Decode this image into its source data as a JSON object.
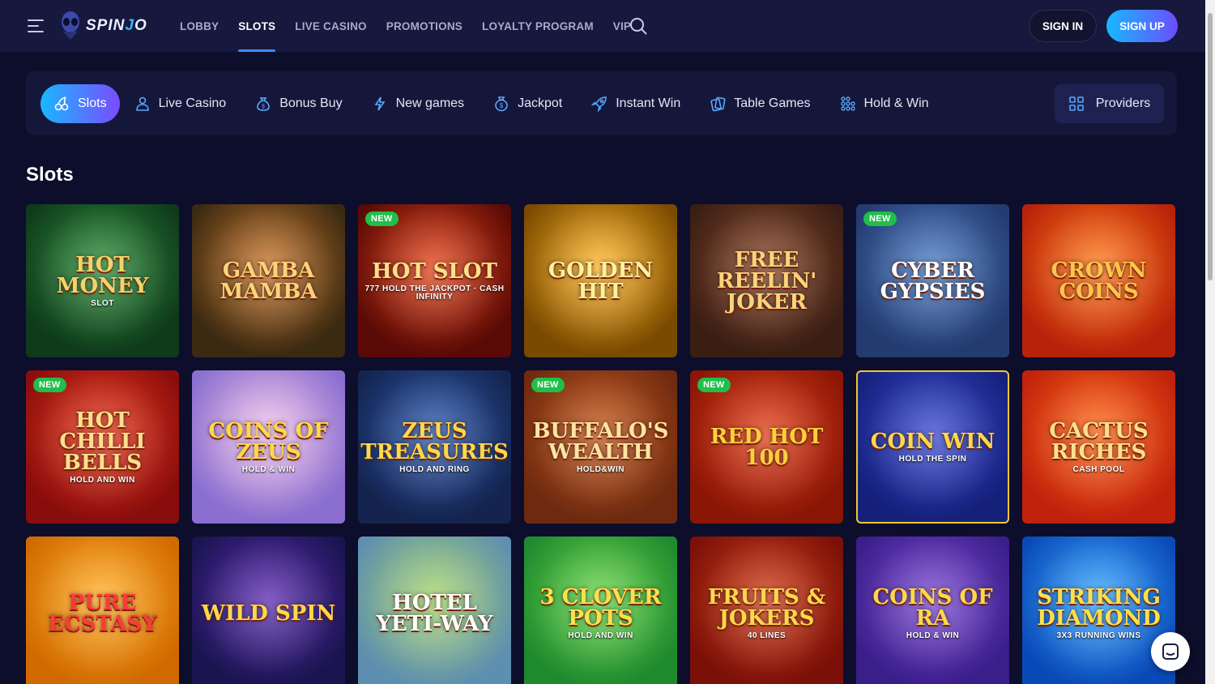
{
  "brand": {
    "logo_text_a": "SPIN",
    "logo_text_b": "J",
    "logo_text_c": "O"
  },
  "nav": {
    "items": [
      {
        "label": "LOBBY",
        "active": false
      },
      {
        "label": "SLOTS",
        "active": true
      },
      {
        "label": "LIVE CASINO",
        "active": false
      },
      {
        "label": "PROMOTIONS",
        "active": false
      },
      {
        "label": "LOYALTY PROGRAM",
        "active": false
      },
      {
        "label": "VIP",
        "active": false
      }
    ],
    "search_icon": "search-icon",
    "signin_label": "SIGN IN",
    "signup_label": "SIGN UP"
  },
  "categories": {
    "items": [
      {
        "label": "Slots",
        "icon": "cherries-icon"
      },
      {
        "label": "Live Casino",
        "icon": "dealer-icon"
      },
      {
        "label": "Bonus Buy",
        "icon": "money-bag-icon"
      },
      {
        "label": "New games",
        "icon": "lightning-icon"
      },
      {
        "label": "Jackpot",
        "icon": "coin-bag-icon"
      },
      {
        "label": "Instant Win",
        "icon": "rocket-icon"
      },
      {
        "label": "Table Games",
        "icon": "cards-icon"
      },
      {
        "label": "Hold & Win",
        "icon": "dots-grid-icon"
      }
    ],
    "providers_label": "Providers"
  },
  "section": {
    "title": "Slots"
  },
  "badge_new": "NEW",
  "games": [
    {
      "title": "Hot Money",
      "sub": "Slot",
      "new": false,
      "bg": "#0f3a1c",
      "accent": "#2f8f3a",
      "color": "#f3d36b"
    },
    {
      "title": "Gamba Mamba",
      "sub": "",
      "new": false,
      "bg": "#3b2a12",
      "accent": "#c8752a",
      "color": "#ffd27a"
    },
    {
      "title": "Hot Slot",
      "sub": "777 HOLD THE JACKPOT · CASH INFINITY",
      "new": true,
      "bg": "#5a0a06",
      "accent": "#e5451a",
      "color": "#ffe08a"
    },
    {
      "title": "Golden Hit",
      "sub": "",
      "new": false,
      "bg": "#7a4a00",
      "accent": "#ffb62a",
      "color": "#fff0a0"
    },
    {
      "title": "Free Reelin' Joker",
      "sub": "",
      "new": false,
      "bg": "#3a1e14",
      "accent": "#8a4a2a",
      "color": "#ffd27a"
    },
    {
      "title": "Cyber Gypsies",
      "sub": "",
      "new": true,
      "bg": "#233b6e",
      "accent": "#4d7bc4",
      "color": "#ffffff"
    },
    {
      "title": "Crown Coins",
      "sub": "",
      "new": false,
      "bg": "#b8220a",
      "accent": "#ff7a1a",
      "color": "#ffc44a"
    },
    {
      "title": "Hot Chilli Bells",
      "sub": "HOLD AND WIN",
      "new": true,
      "bg": "#8a0d0d",
      "accent": "#e83a1c",
      "color": "#ffe08a"
    },
    {
      "title": "Coins of Zeus",
      "sub": "HOLD & WIN",
      "new": false,
      "bg": "#8a6fd0",
      "accent": "#f0c0e8",
      "color": "#ffd84a"
    },
    {
      "title": "Zeus Treasures",
      "sub": "HOLD AND RING",
      "new": false,
      "bg": "#14244e",
      "accent": "#2e5ab0",
      "color": "#ffd84a"
    },
    {
      "title": "Buffalo's Wealth",
      "sub": "HOLD&WIN",
      "new": true,
      "bg": "#6e2a10",
      "accent": "#c4581c",
      "color": "#ffe4a0"
    },
    {
      "title": "Red Hot 100",
      "sub": "",
      "new": true,
      "bg": "#8a1606",
      "accent": "#e0401a",
      "color": "#ffcf3a"
    },
    {
      "title": "Coin Win",
      "sub": "HOLD THE SPIN",
      "new": false,
      "bg": "#15207a",
      "accent": "#3a4ad0",
      "color": "#ffd84a",
      "highlight": true
    },
    {
      "title": "Cactus Riches",
      "sub": "CASH POOL",
      "new": false,
      "bg": "#c0220c",
      "accent": "#ff6a1a",
      "color": "#ffe08a"
    },
    {
      "title": "Pure Ecstasy",
      "sub": "",
      "new": false,
      "bg": "#d06a00",
      "accent": "#ffae2a",
      "color": "#ff3a3a"
    },
    {
      "title": "Wild Spin",
      "sub": "",
      "new": false,
      "bg": "#1a1550",
      "accent": "#5a2ab0",
      "color": "#ffd84a"
    },
    {
      "title": "Hotel Yeti-Way",
      "sub": "",
      "new": false,
      "bg": "#5e8fb0",
      "accent": "#a6d46a",
      "color": "#ffffff"
    },
    {
      "title": "3 Clover Pots",
      "sub": "HOLD AND WIN",
      "new": false,
      "bg": "#1e8a2e",
      "accent": "#6ad44a",
      "color": "#ffe04a"
    },
    {
      "title": "Fruits & Jokers",
      "sub": "40 LINES",
      "new": false,
      "bg": "#7a1008",
      "accent": "#d0401a",
      "color": "#ffd84a"
    },
    {
      "title": "Coins of Ra",
      "sub": "HOLD & WIN",
      "new": false,
      "bg": "#3a1e8a",
      "accent": "#7a4ad0",
      "color": "#ffd84a"
    },
    {
      "title": "Striking Diamond",
      "sub": "3X3 RUNNING WINS",
      "new": false,
      "bg": "#0a4ab8",
      "accent": "#3aa8ff",
      "color": "#ffe04a"
    }
  ],
  "chat_icon": "chat-icon"
}
